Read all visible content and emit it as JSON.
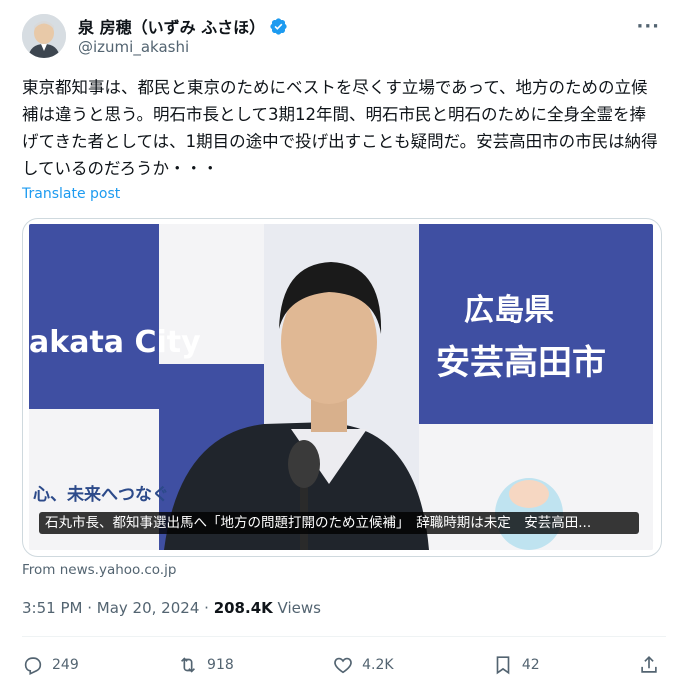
{
  "author": {
    "display_name": "泉 房穂（いずみ ふさほ）",
    "handle": "@izumi_akashi",
    "verified": true
  },
  "post": {
    "text": "東京都知事は、都民と東京のためにベストを尽くす立場であって、地方のための立候補は違うと思う。明石市長として3期12年間、明石市民と明石のために全身全霊を捧げてきた者としては、1期目の途中で投げ出すことも疑問だ。安芸高田市の市民は納得しているのだろうか・・・",
    "translate_label": "Translate post"
  },
  "media": {
    "caption": "石丸市長、都知事選出馬へ「地方の問題打開のため立候補」　辞職時期は未定　安芸高田...",
    "backdrop_left_text": "akata City",
    "backdrop_right_line1": "広島県",
    "backdrop_right_line2": "安芸高田市",
    "backdrop_bottom_text": "心、未来へつなぐ",
    "source": "From news.yahoo.co.jp"
  },
  "meta": {
    "time": "3:51 PM",
    "date": "May 20, 2024",
    "views_count": "208.4K",
    "views_label": "Views"
  },
  "actions": {
    "replies": "249",
    "reposts": "918",
    "likes": "4.2K",
    "bookmarks": "42"
  },
  "colors": {
    "accent": "#1d9bf0",
    "text": "#0f1419",
    "muted": "#536471",
    "backdrop_blue": "#3f4fa2"
  }
}
